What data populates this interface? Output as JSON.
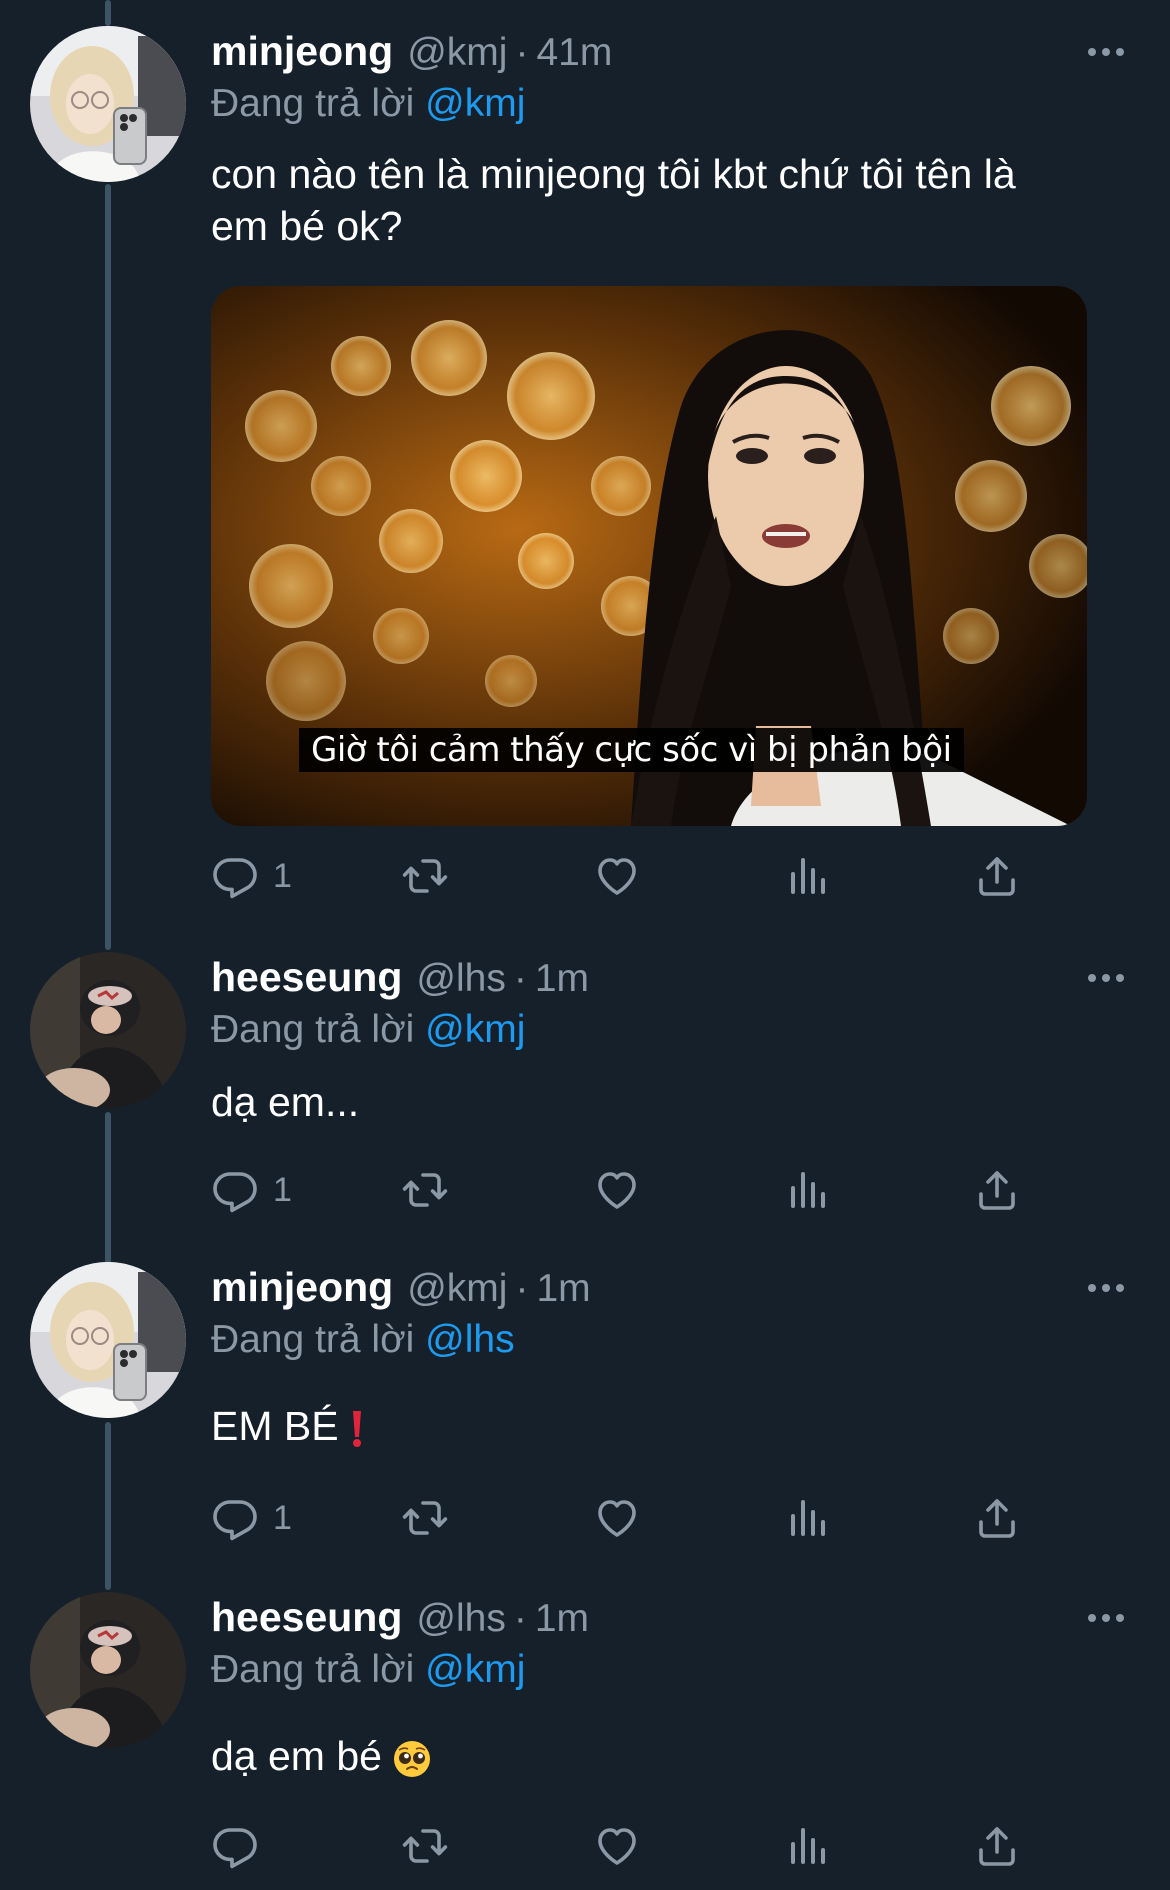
{
  "colors": {
    "background": "#15202b",
    "text_primary": "#ffffff",
    "text_secondary": "#8b98a5",
    "mention": "#1d9bf0",
    "thread_line": "#3d5466"
  },
  "tweets": [
    {
      "display_name": "minjeong",
      "handle": "@kmj",
      "separator": "·",
      "time": "41m",
      "reply_prefix": "Đang trả lời",
      "reply_to": "@kmj",
      "text_line1": "con nào tên là minjeong tôi kbt chứ tôi tên là",
      "text_line2": "em bé ok?",
      "media_caption": "Giờ tôi cảm thấy cực sốc vì bị phản bội",
      "reply_count": "1",
      "avatar_icon": "minjeong-avatar"
    },
    {
      "display_name": "heeseung",
      "handle": "@lhs",
      "separator": "·",
      "time": "1m",
      "reply_prefix": "Đang trả lời",
      "reply_to": "@kmj",
      "text": "dạ em...",
      "reply_count": "1",
      "avatar_icon": "heeseung-avatar"
    },
    {
      "display_name": "minjeong",
      "handle": "@kmj",
      "separator": "·",
      "time": "1m",
      "reply_prefix": "Đang trả lời",
      "reply_to": "@lhs",
      "text": "EM BÉ",
      "emoji": "red-exclamation-mark",
      "reply_count": "1",
      "avatar_icon": "minjeong-avatar"
    },
    {
      "display_name": "heeseung",
      "handle": "@lhs",
      "separator": "·",
      "time": "1m",
      "reply_prefix": "Đang trả lời",
      "reply_to": "@kmj",
      "text": "dạ em bé",
      "emoji": "pleading-face",
      "reply_count": "",
      "avatar_icon": "heeseung-avatar"
    }
  ],
  "action_icons": [
    "reply-icon",
    "retweet-icon",
    "like-icon",
    "views-icon",
    "share-icon"
  ],
  "more_icon": "more-options-icon"
}
